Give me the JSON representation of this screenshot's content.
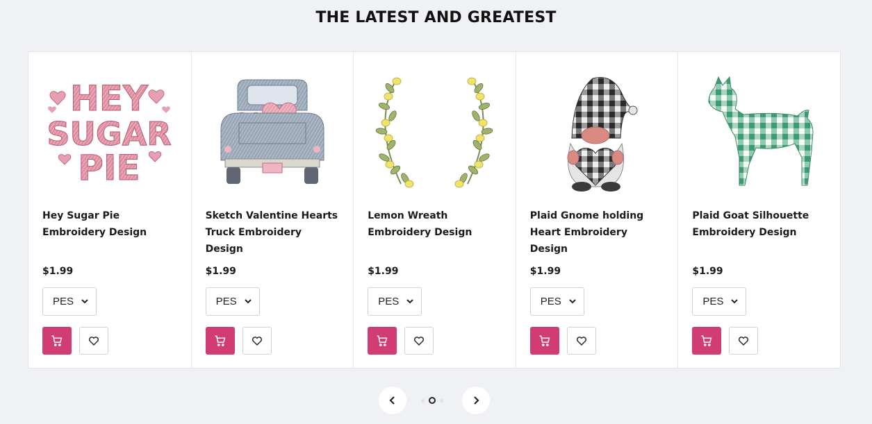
{
  "section": {
    "title": "THE LATEST AND GREATEST"
  },
  "products": [
    {
      "name": "Hey Sugar Pie Embroidery Design",
      "price": "$1.99",
      "format": "PES",
      "icon": "hey-sugar-pie-design-image"
    },
    {
      "name": "Sketch Valentine Hearts Truck Embroidery Design",
      "price": "$1.99",
      "format": "PES",
      "icon": "valentine-hearts-truck-design-image"
    },
    {
      "name": "Lemon Wreath Embroidery Design",
      "price": "$1.99",
      "format": "PES",
      "icon": "lemon-wreath-design-image"
    },
    {
      "name": "Plaid Gnome holding Heart Embroidery Design",
      "price": "$1.99",
      "format": "PES",
      "icon": "plaid-gnome-design-image"
    },
    {
      "name": "Plaid Goat Silhouette Embroidery Design",
      "price": "$1.99",
      "format": "PES",
      "icon": "plaid-goat-design-image"
    }
  ],
  "thumbnail_text": {
    "line1": "HEY",
    "line2": "SUGAR",
    "line3": "PIE"
  },
  "carousel": {
    "pages": 3,
    "current_page": 2
  },
  "colors": {
    "accent": "#d13c75",
    "background": "#f0f1f5"
  }
}
